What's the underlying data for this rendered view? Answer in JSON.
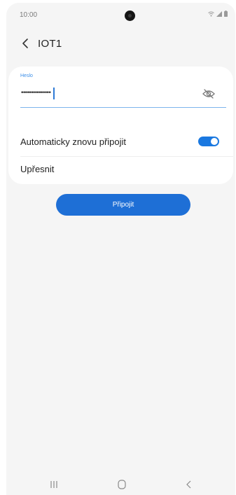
{
  "status_bar": {
    "time": "10:00",
    "icons": [
      "wifi-icon",
      "signal-icon",
      "battery-icon"
    ]
  },
  "header": {
    "back_icon": "chevron-left-icon",
    "title": "IOT1"
  },
  "password_field": {
    "label": "Heslo",
    "value": "•••••••••••••••",
    "visibility_icon": "eye-off-icon"
  },
  "settings": {
    "auto_reconnect_label": "Automaticky znovu připojit",
    "auto_reconnect_on": true,
    "advanced_label": "Upřesnit"
  },
  "connect_button": {
    "label": "Připojit"
  },
  "navigation_bar": {
    "icons": [
      "recents-icon",
      "home-icon",
      "back-icon"
    ]
  },
  "colors": {
    "accent": "#1e6fd6",
    "field_label": "#3b8ee8",
    "background": "#f5f5f5"
  }
}
